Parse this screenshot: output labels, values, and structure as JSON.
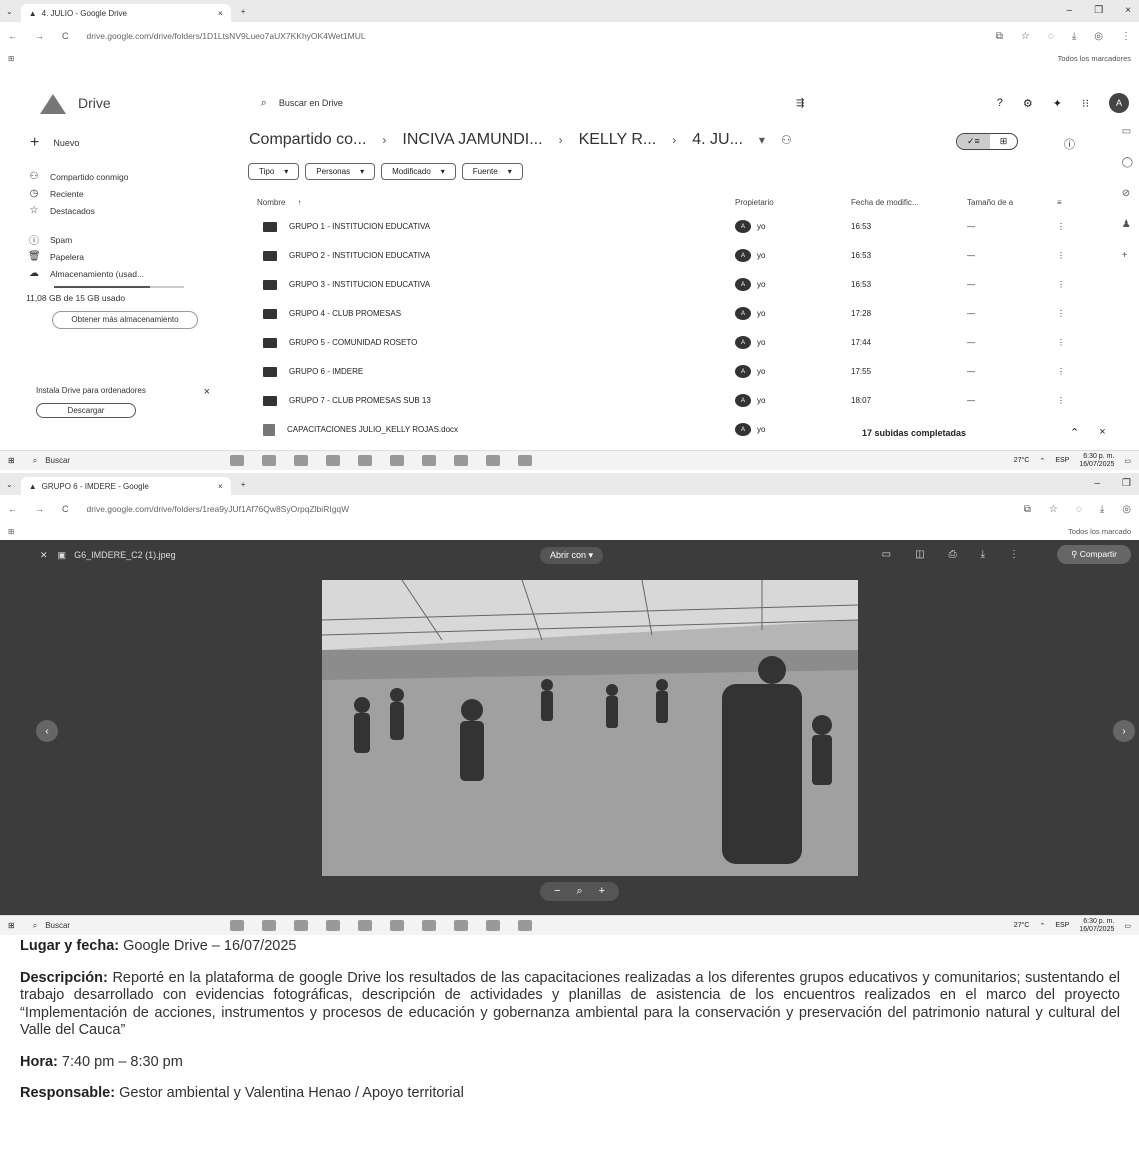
{
  "shot1": {
    "tab_title": "4. JULIO - Google Drive",
    "url": "drive.google.com/drive/folders/1D1LtsNV9Lueo7aUX7KKhyOK4Wet1MUL",
    "bookmarks_label": "Todos los marcadores",
    "app_name": "Drive",
    "search_placeholder": "Buscar en Drive",
    "avatar_letter": "A",
    "new_label": "Nuevo",
    "nav": [
      {
        "label": "Compartido conmigo",
        "icon": "shared-icon"
      },
      {
        "label": "Reciente",
        "icon": "clock-icon"
      },
      {
        "label": "Destacados",
        "icon": "star-icon"
      },
      {
        "label": "Spam",
        "icon": "spam-icon"
      },
      {
        "label": "Papelera",
        "icon": "trash-icon"
      },
      {
        "label": "Almacenamiento (usad...",
        "icon": "cloud-icon"
      }
    ],
    "storage_text": "11,08 GB de 15 GB usado",
    "storage_fraction": 0.74,
    "get_more": "Obtener más almacenamiento",
    "install_text": "Instala Drive para ordenadores",
    "download_label": "Descargar",
    "breadcrumbs": [
      "Compartido co...",
      "INCIVA JAMUNDI...",
      "KELLY R...",
      "4. JU..."
    ],
    "filters": [
      "Tipo",
      "Personas",
      "Modificado",
      "Fuente"
    ],
    "columns": {
      "name": "Nombre",
      "owner": "Propietario",
      "date": "Fecha de modific...",
      "size": "Tamaño de a"
    },
    "files": [
      {
        "name": "GRUPO 1 - INSTITUCION EDUCATIVA",
        "owner": "yo",
        "date": "16:53",
        "size": "—",
        "kind": "folder"
      },
      {
        "name": "GRUPO 2 - INSTITUCION EDUCATIVA",
        "owner": "yo",
        "date": "16:53",
        "size": "—",
        "kind": "folder"
      },
      {
        "name": "GRUPO 3 - INSTITUCION EDUCATIVA",
        "owner": "yo",
        "date": "16:53",
        "size": "—",
        "kind": "folder"
      },
      {
        "name": "GRUPO 4 - CLUB PROMESAS",
        "owner": "yo",
        "date": "17:28",
        "size": "—",
        "kind": "folder"
      },
      {
        "name": "GRUPO 5 - COMUNIDAD ROSETO",
        "owner": "yo",
        "date": "17:44",
        "size": "—",
        "kind": "folder"
      },
      {
        "name": "GRUPO 6 - IMDERE",
        "owner": "yo",
        "date": "17:55",
        "size": "—",
        "kind": "folder"
      },
      {
        "name": "GRUPO 7 - CLUB PROMESAS SUB 13",
        "owner": "yo",
        "date": "18:07",
        "size": "—",
        "kind": "folder"
      },
      {
        "name": "CAPACITACIONES JULIO_KELLY ROJAS.docx",
        "owner": "yo",
        "date": "",
        "size": "",
        "kind": "doc"
      }
    ],
    "uploads_status": "17 subidas completadas",
    "taskbar_search": "Buscar",
    "weather": "27°C",
    "lang": "ESP",
    "time": "6:30 p. m.",
    "date": "16/07/2025"
  },
  "shot2": {
    "tab_title": "GRUPO 6 - IMDERE - Google",
    "url": "drive.google.com/drive/folders/1rea9yJUf1Af76Qw8SyOrpqZlbiRIgqW",
    "bookmarks_label": "Todos los marcado",
    "file_name": "G6_IMDERE_C2 (1).jpeg",
    "open_with": "Abrir con",
    "share_label": "Compartir",
    "taskbar_search": "Buscar",
    "weather": "27°C",
    "lang": "ESP",
    "time": "6:30 p. m.",
    "date": "16/07/2025"
  },
  "caption": {
    "place_label": "Lugar y fecha:",
    "place_value": " Google Drive – 16/07/2025",
    "desc_label": "Descripción:",
    "desc_value": " Reporté en la plataforma de google Drive los resultados de las capacitaciones realizadas a los diferentes grupos educativos y comunitarios; sustentando el trabajo desarrollado con evidencias fotográficas, descripción de actividades y planillas de asistencia de los encuentros realizados en el marco del proyecto “Implementación de acciones, instrumentos y procesos de educación y gobernanza ambiental para la conservación y preservación del patrimonio natural y cultural del Valle del Cauca”",
    "time_label": "Hora:",
    "time_value": " 7:40 pm – 8:30 pm",
    "resp_label": "Responsable:",
    "resp_value": " Gestor ambiental y Valentina Henao / Apoyo territorial"
  }
}
